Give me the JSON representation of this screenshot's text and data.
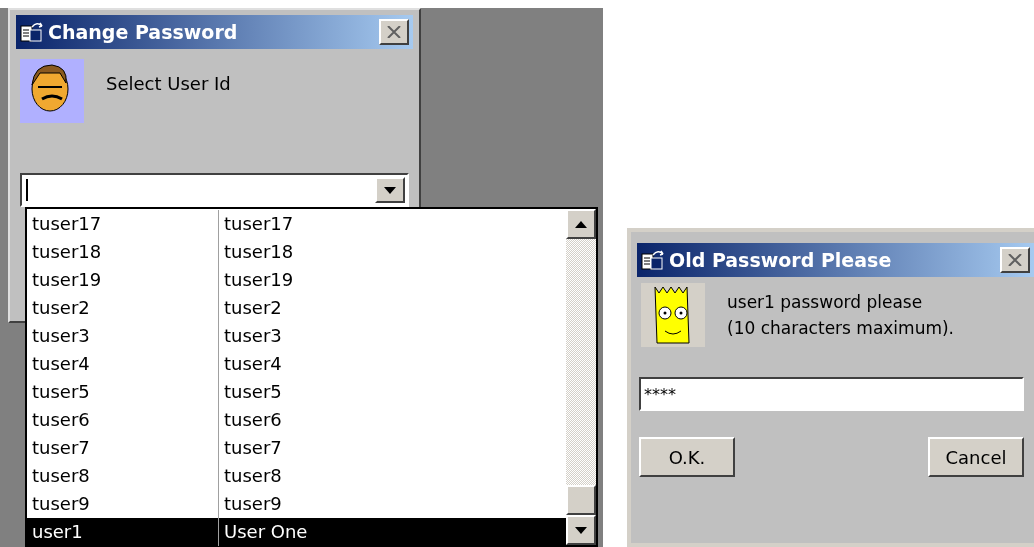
{
  "change_password": {
    "title": "Change Password",
    "prompt": "Select User Id"
  },
  "user_list": [
    {
      "id": "tuser17",
      "name": "tuser17",
      "selected": false
    },
    {
      "id": "tuser18",
      "name": "tuser18",
      "selected": false
    },
    {
      "id": "tuser19",
      "name": "tuser19",
      "selected": false
    },
    {
      "id": "tuser2",
      "name": "tuser2",
      "selected": false
    },
    {
      "id": "tuser3",
      "name": "tuser3",
      "selected": false
    },
    {
      "id": "tuser4",
      "name": "tuser4",
      "selected": false
    },
    {
      "id": "tuser5",
      "name": "tuser5",
      "selected": false
    },
    {
      "id": "tuser6",
      "name": "tuser6",
      "selected": false
    },
    {
      "id": "tuser7",
      "name": "tuser7",
      "selected": false
    },
    {
      "id": "tuser8",
      "name": "tuser8",
      "selected": false
    },
    {
      "id": "tuser9",
      "name": "tuser9",
      "selected": false
    },
    {
      "id": "user1",
      "name": "User One",
      "selected": true
    }
  ],
  "old_password": {
    "title": "Old Password Please",
    "message": [
      "user1 password please",
      "(10 characters maximum)."
    ],
    "password": "****",
    "buttons": [
      "O.K.",
      "Cancel"
    ]
  }
}
